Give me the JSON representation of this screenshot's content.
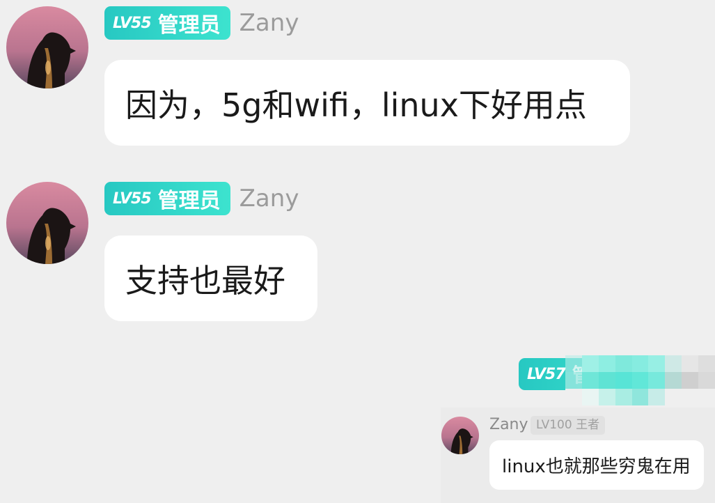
{
  "messages": [
    {
      "level": "LV55",
      "role": "管理员",
      "username": "Zany",
      "text": "因为，5g和wifi，linux下好用点"
    },
    {
      "level": "LV55",
      "role": "管理员",
      "username": "Zany",
      "text": "支持也最好"
    }
  ],
  "quoted": {
    "sender_level": "LV57",
    "sender_role_partial": "管理",
    "reply_user": "Zany",
    "reply_level": "LV100 王者",
    "reply_text": "linux也就那些穷鬼在用"
  },
  "colors": {
    "badge_start": "#27c8c2",
    "badge_end": "#3de3cf",
    "background": "#efefef",
    "username": "#9b9b9b"
  }
}
